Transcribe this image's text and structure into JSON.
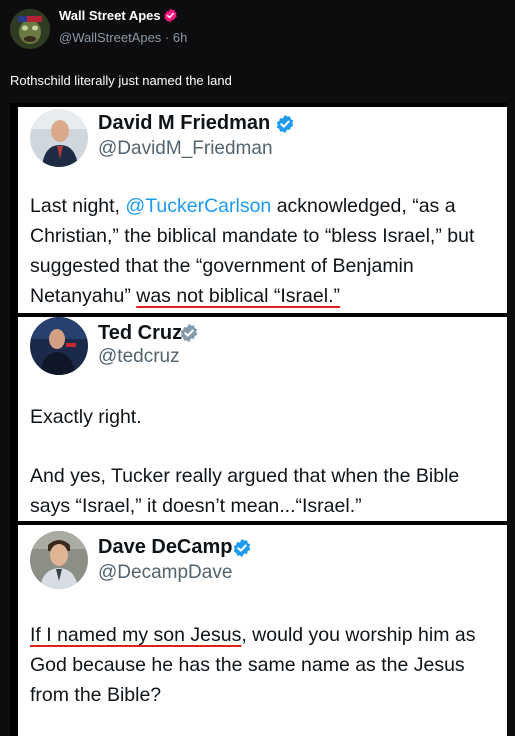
{
  "post": {
    "author_name": "Wall Street Apes",
    "author_handle": "@WallStreetApes",
    "separator": " · ",
    "time": "6h",
    "text": "Rothschild literally just named the land"
  },
  "cards": [
    {
      "name": "David M Friedman",
      "handle": "@DavidM_Friedman",
      "body": {
        "p1": "Last night, ",
        "mention": "@TuckerCarlson",
        "p2": " acknowledged, “as a Christian,” the biblical mandate to “bless Israel,” but suggested that the “government of Benjamin Netanyahu” ",
        "underlined": "was not biblical  “Israel.”"
      }
    },
    {
      "name": "Ted Cruz",
      "handle": "@tedcruz",
      "body": {
        "line1": "Exactly right.",
        "line2": "And yes, Tucker really argued that when the Bible says “Israel,” it doesn’t mean...“Israel.”"
      }
    },
    {
      "name": "Dave DeCamp",
      "handle": "@DecampDave",
      "body": {
        "underlined": "If I named my son Jesus",
        "rest": ", would you worship him as God because he has the same name as the Jesus from the Bible?"
      }
    }
  ],
  "colors": {
    "background": "#0d0d0f",
    "verified_blue": "#1d9bf0",
    "verified_gray": "#829aab",
    "verified_pink": "#f91880",
    "underline_red": "#e02020"
  },
  "icons": {
    "post_badge": "verified-badge-icon",
    "card_badges": [
      "verified-blue-badge-icon",
      "verified-gray-badge-icon",
      "verified-blue-badge-icon"
    ]
  }
}
